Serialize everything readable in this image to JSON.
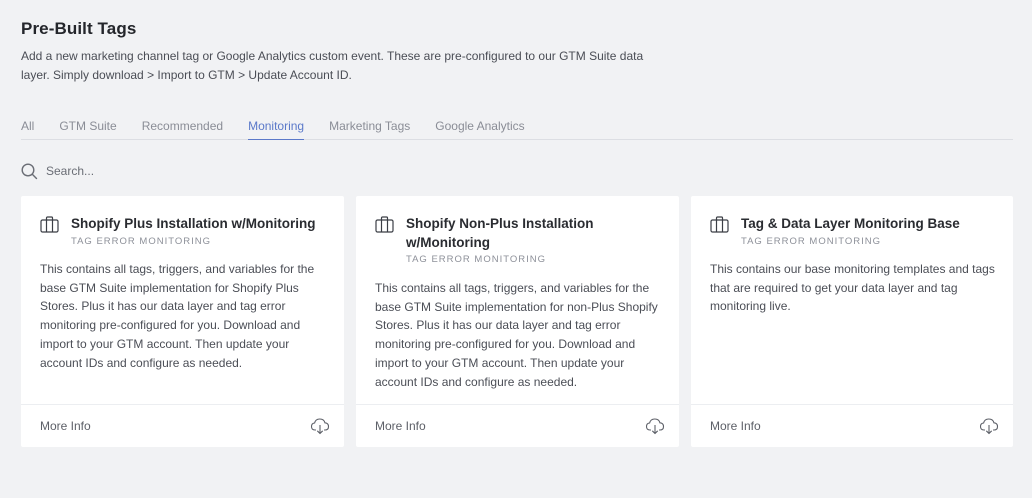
{
  "page": {
    "title": "Pre-Built Tags",
    "subtitle": "Add a new marketing channel tag or Google Analytics custom event. These are pre-configured to our GTM Suite data layer. Simply download > Import to GTM > Update Account ID."
  },
  "tabs": [
    {
      "label": "All"
    },
    {
      "label": "GTM Suite"
    },
    {
      "label": "Recommended"
    },
    {
      "label": "Monitoring",
      "active": true
    },
    {
      "label": "Marketing Tags"
    },
    {
      "label": "Google Analytics"
    }
  ],
  "search": {
    "placeholder": "Search...",
    "icon": "search-icon"
  },
  "cards": [
    {
      "title": "Shopify Plus Installation w/Monitoring",
      "category": "TAG ERROR MONITORING",
      "description": "This contains all tags, triggers, and variables for the base GTM Suite implementation for Shopify Plus Stores. Plus it has our data layer and tag error monitoring pre-configured for you. Download and import to your GTM account. Then update your account IDs and configure as needed.",
      "more_label": "More Info",
      "icon": "briefcase-icon"
    },
    {
      "title": "Shopify Non-Plus Installation w/Monitoring",
      "category": "TAG ERROR MONITORING",
      "description": "This contains all tags, triggers, and variables for the base GTM Suite implementation for non-Plus Shopify Stores. Plus it has our data layer and tag error monitoring pre-configured for you. Download and import to your GTM account. Then update your account IDs and configure as needed.",
      "more_label": "More Info",
      "icon": "briefcase-icon"
    },
    {
      "title": "Tag & Data Layer Monitoring Base",
      "category": "TAG ERROR MONITORING",
      "description": "This contains our base monitoring templates and tags that are required to get your data layer and tag monitoring live.",
      "more_label": "More Info",
      "icon": "briefcase-icon"
    }
  ],
  "colors": {
    "accent": "#5b79c9",
    "background": "#f1f2f4",
    "card": "#ffffff"
  }
}
